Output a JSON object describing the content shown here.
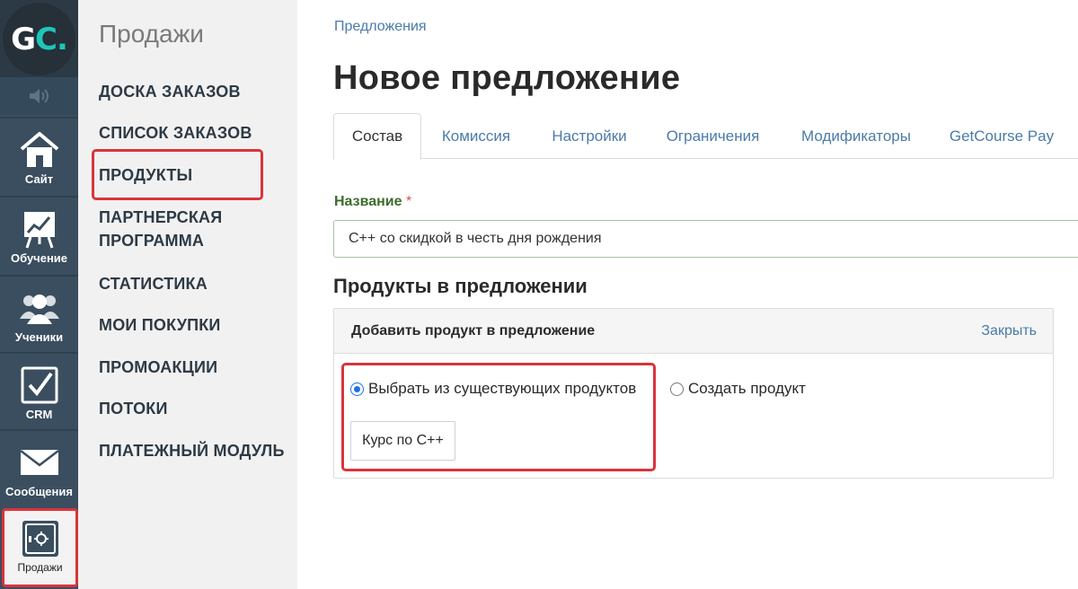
{
  "logo": {
    "g": "G",
    "c": "C",
    "dot": "."
  },
  "rail": [
    {
      "label": "Сайт",
      "icon": "home-icon"
    },
    {
      "label": "Обучение",
      "icon": "chart-board-icon"
    },
    {
      "label": "Ученики",
      "icon": "users-icon"
    },
    {
      "label": "CRM",
      "icon": "checkbox-icon"
    },
    {
      "label": "Сообщения",
      "icon": "envelope-icon"
    },
    {
      "label": "Продажи",
      "icon": "safe-icon",
      "active": true
    }
  ],
  "sidebar": {
    "title": "Продажи",
    "items": [
      {
        "label": "ДОСКА ЗАКАЗОВ"
      },
      {
        "label": "СПИСОК ЗАКАЗОВ"
      },
      {
        "label": "ПРОДУКТЫ"
      },
      {
        "label": "ПАРТНЕРСКАЯ ПРОГРАММА"
      },
      {
        "label": "СТАТИСТИКА"
      },
      {
        "label": "МОИ ПОКУПКИ"
      },
      {
        "label": "ПРОМОАКЦИИ"
      },
      {
        "label": "ПОТОКИ"
      },
      {
        "label": "ПЛАТЕЖНЫЙ МОДУЛЬ"
      }
    ],
    "partner_line1": "ПАРТНЕРСКАЯ",
    "partner_line2": "ПРОГРАММА"
  },
  "main": {
    "breadcrumb": "Предложения",
    "title": "Новое предложение",
    "tabs": [
      {
        "label": "Состав",
        "active": true
      },
      {
        "label": "Комиссия"
      },
      {
        "label": "Настройки"
      },
      {
        "label": "Ограничения"
      },
      {
        "label": "Модификаторы"
      },
      {
        "label": "GetCourse Pay"
      }
    ],
    "name_label": "Название",
    "required_mark": "*",
    "name_value": "C++ со скидкой в честь дня рождения",
    "section_title": "Продукты в предложении",
    "panel": {
      "title": "Добавить продукт в предложение",
      "close_label": "Закрыть",
      "radio_existing": "Выбрать из существующих продуктов",
      "radio_create": "Создать продукт",
      "selected_option": "Выбрать из существующих продуктов",
      "product_button": "Курс по С++"
    }
  },
  "colors": {
    "rail_bg": "#3a4e5f",
    "sidebar_bg": "#f1f1f1",
    "link": "#4a7ba8",
    "highlight": "#d9343b",
    "accent": "#1ec6b9"
  }
}
